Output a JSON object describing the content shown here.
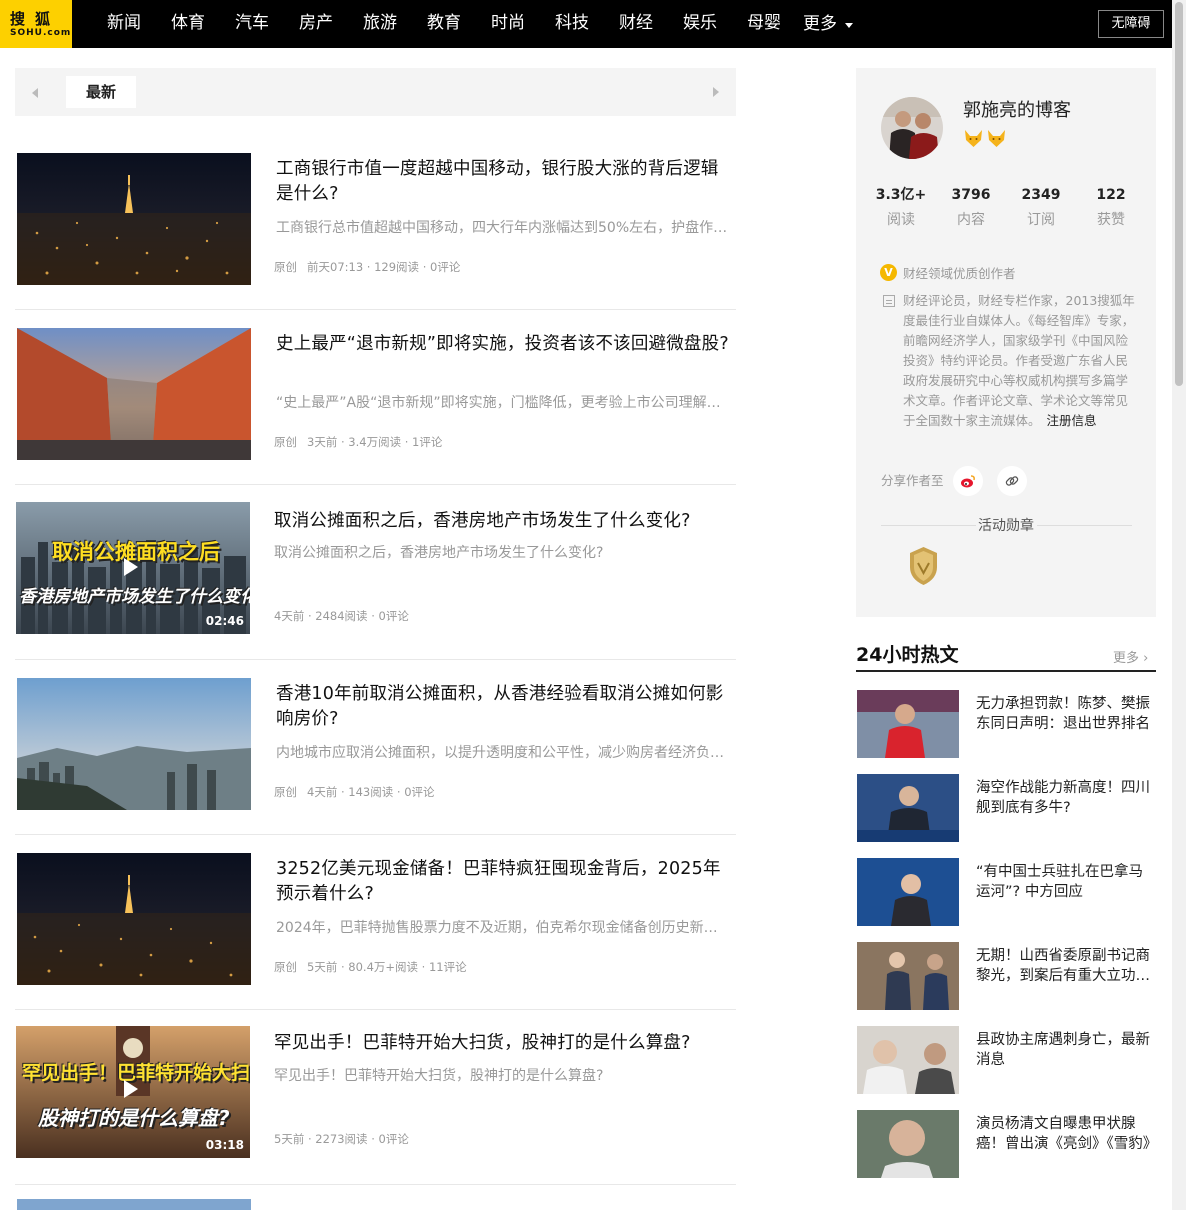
{
  "header": {
    "logo_top": "搜狐",
    "logo_bottom": "SOHU.com",
    "nav": [
      "新闻",
      "体育",
      "汽车",
      "房产",
      "旅游",
      "教育",
      "时尚",
      "科技",
      "财经",
      "娱乐",
      "母婴"
    ],
    "more": "更多",
    "accessibility": "无障碍"
  },
  "tabs": {
    "active": "最新"
  },
  "articles": [
    {
      "title": "工商银行市值一度超越中国移动，银行股大涨的背后逻辑是什么?",
      "desc": "工商银行总市值超越中国移动，四大行年内涨幅达到50%左右，护盘作用显著。",
      "badge": "原创",
      "meta": "前天07:13 · 129阅读 · 0评论"
    },
    {
      "title": "史上最严“退市新规”即将实施，投资者该不该回避微盘股?",
      "desc": "“史上最严”A股“退市新规”即将实施，门槛降低，更考验上市公司理解程度。",
      "badge": "原创",
      "meta": "3天前 · 3.4万阅读 · 1评论"
    },
    {
      "title": "取消公摊面积之后，香港房地产市场发生了什么变化?",
      "desc": "取消公摊面积之后，香港房地产市场发生了什么变化?",
      "badge": "",
      "meta": "4天前 · 2484阅读 · 0评论",
      "video_text1": "取消公摊面积之后",
      "video_text2": "香港房地产市场发生了什么变化?",
      "duration": "02:46"
    },
    {
      "title": "香港10年前取消公摊面积，从香港经验看取消公摊如何影响房价?",
      "desc": "内地城市应取消公摊面积，以提升透明度和公平性，减少购房者经济负担。",
      "badge": "原创",
      "meta": "4天前 · 143阅读 · 0评论"
    },
    {
      "title": "3252亿美元现金储备！巴菲特疯狂囤现金背后，2025年预示着什么?",
      "desc": "2024年，巴菲特抛售股票力度不及近期，伯克希尔现金储备创历史新高。",
      "badge": "原创",
      "meta": "5天前 · 80.4万+阅读 · 11评论"
    },
    {
      "title": "罕见出手！巴菲特开始大扫货，股神打的是什么算盘?",
      "desc": "罕见出手！巴菲特开始大扫货，股神打的是什么算盘?",
      "badge": "",
      "meta": "5天前 · 2273阅读 · 0评论",
      "video_text1": "罕见出手！巴菲特开始大扫货",
      "video_text2": "股神打的是什么算盘?",
      "duration": "03:18"
    }
  ],
  "author": {
    "name": "郭施亮的博客",
    "stats": [
      {
        "num": "3.3亿+",
        "label": "阅读"
      },
      {
        "num": "3796",
        "label": "内容"
      },
      {
        "num": "2349",
        "label": "订阅"
      },
      {
        "num": "122",
        "label": "获赞"
      }
    ],
    "qualification_badge": "V",
    "qualification": "财经领域优质创作者",
    "bio": "财经评论员，财经专栏作家，2013搜狐年度最佳行业自媒体人。《每经智库》专家，前瞻网经济学人，国家级学刊《中国风险投资》特约评论员。作者受邀广东省人民政府发展研究中心等权威机构撰写多篇学术文章。作者评论文章、学术论文等常见于全国数十家主流媒体。",
    "register_link": "注册信息",
    "share_label": "分享作者至",
    "activity_title": "活动勋章"
  },
  "hot": {
    "title": "24小时热文",
    "more": "更多",
    "items": [
      "无力承担罚款！陈梦、樊振东同日声明：退出世界排名",
      "海空作战能力新高度！四川舰到底有多牛?",
      "“有中国士兵驻扎在巴拿马运河”? 中方回应",
      "无期！山西省委原副书记商黎光，到案后有重大立功表现",
      "县政协主席遇刺身亡，最新消息",
      "演员杨清文自曝患甲状腺癌！曾出演《亮剑》《雪豹》"
    ]
  },
  "colors": {
    "logo_yellow": "#fdd000",
    "topbar": "#000000",
    "panel_bg": "#f4f4f4"
  }
}
